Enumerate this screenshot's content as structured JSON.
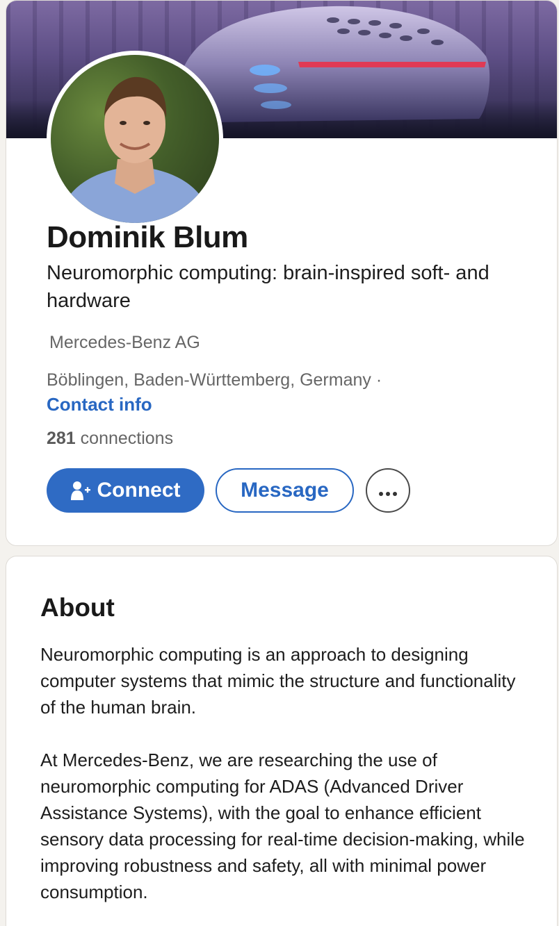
{
  "profile": {
    "name": "Dominik Blum",
    "headline": "Neuromorphic computing: brain-inspired soft- and hardware",
    "company": "Mercedes-Benz AG",
    "location": "Böblingen, Baden-Württemberg, Germany ·",
    "contact_link": "Contact info",
    "connections_count": "281",
    "connections_label": " connections"
  },
  "actions": {
    "connect_label": "Connect",
    "message_label": "Message",
    "more_icon": "ellipsis-icon"
  },
  "about": {
    "title": "About",
    "paragraph1": "Neuromorphic computing is an approach to designing computer systems that mimic the structure and functionality of the human brain.",
    "paragraph2": "At Mercedes-Benz, we are researching the use of neuromorphic computing for ADAS (Advanced Driver Assistance Systems), with the goal to enhance efficient sensory data processing for real-time decision-making, while improving robustness and safety, all with minimal power consumption."
  },
  "colors": {
    "accent": "#2867c2",
    "connect_bg": "#2f6bc4",
    "secondary_text": "#666666",
    "page_bg": "#f4f2ee"
  }
}
